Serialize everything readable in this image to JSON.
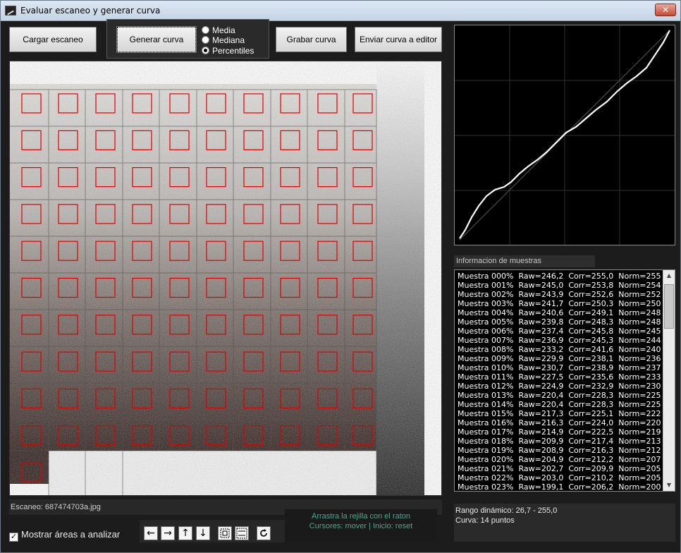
{
  "window": {
    "title": "Evaluar escaneo y generar curva",
    "close_label": "✕"
  },
  "toolbar": {
    "load_label": "Cargar escaneo",
    "generate_label": "Generar curva",
    "save_label": "Grabar curva",
    "send_label": "Enviar curva a editor"
  },
  "modes": {
    "options": [
      "Media",
      "Mediana",
      "Percentiles"
    ],
    "selected": "Percentiles"
  },
  "scan": {
    "filename_label": "Escaneo: 687474703a.jpg"
  },
  "grid": {
    "rows": 11,
    "cols": 10
  },
  "hint": {
    "line1": "Arrastra la rejilla con el raton",
    "line2": "Cursores: mover  |  Inicio: reset"
  },
  "show_areas": {
    "label": "Mostrar áreas a analizar",
    "checked": true
  },
  "nav": {
    "left": "←",
    "right": "→",
    "up": "↑",
    "down": "↓"
  },
  "samples": {
    "caption": "Informacion de muestras",
    "rows": [
      "Muestra 000%  Raw=246,2  Corr=255,0  Norm=255",
      "Muestra 001%  Raw=245,0  Corr=253,8  Norm=254",
      "Muestra 002%  Raw=243,9  Corr=252,6  Norm=252",
      "Muestra 003%  Raw=241,7  Corr=250,3  Norm=250",
      "Muestra 004%  Raw=240,6  Corr=249,1  Norm=248",
      "Muestra 005%  Raw=239,8  Corr=248,3  Norm=248",
      "Muestra 006%  Raw=237,4  Corr=245,8  Norm=245",
      "Muestra 007%  Raw=236,9  Corr=245,3  Norm=244",
      "Muestra 008%  Raw=233,2  Corr=241,6  Norm=240",
      "Muestra 009%  Raw=229,9  Corr=238,1  Norm=236",
      "Muestra 010%  Raw=230,7  Corr=238,9  Norm=237",
      "Muestra 011%  Raw=227,5  Corr=235,6  Norm=233",
      "Muestra 012%  Raw=224,9  Corr=232,9  Norm=230",
      "Muestra 013%  Raw=220,4  Corr=228,3  Norm=225",
      "Muestra 014%  Raw=220,4  Corr=228,3  Norm=225",
      "Muestra 015%  Raw=217,3  Corr=225,1  Norm=222",
      "Muestra 016%  Raw=216,3  Corr=224,0  Norm=220",
      "Muestra 017%  Raw=214,9  Corr=222,5  Norm=219",
      "Muestra 018%  Raw=209,9  Corr=217,4  Norm=213",
      "Muestra 019%  Raw=208,9  Corr=216,3  Norm=212",
      "Muestra 020%  Raw=204,9  Corr=212,2  Norm=207",
      "Muestra 021%  Raw=202,7  Corr=209,9  Norm=205",
      "Muestra 022%  Raw=203,0  Corr=210,2  Norm=205",
      "Muestra 023%  Raw=199,1  Corr=206,2  Norm=200"
    ]
  },
  "stats": {
    "dynamic_range": "Rango dinámico: 26,7 - 255,0",
    "curve_points": "Curva: 14 puntos"
  }
}
